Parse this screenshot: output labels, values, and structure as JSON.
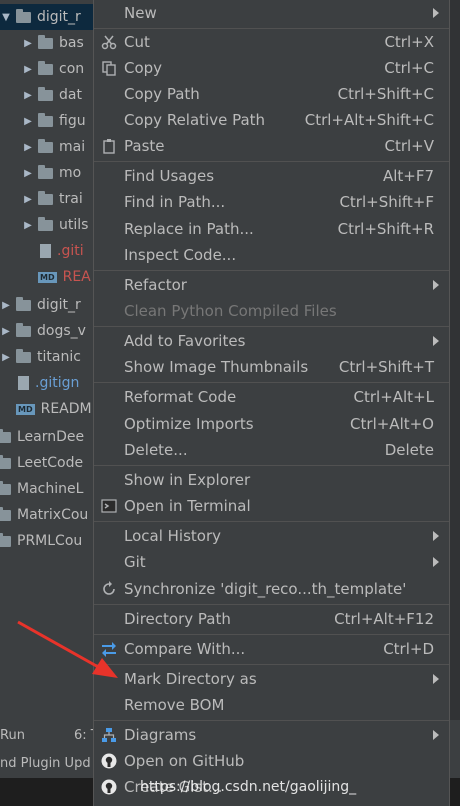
{
  "tree": {
    "items": [
      {
        "label": "digit_r",
        "arrow": "▼",
        "kind": "folder",
        "sel": true
      },
      {
        "label": "bas",
        "arrow": "▶",
        "kind": "folder"
      },
      {
        "label": "con",
        "arrow": "▶",
        "kind": "folder"
      },
      {
        "label": "dat",
        "arrow": "▶",
        "kind": "folder"
      },
      {
        "label": "figu",
        "arrow": "▶",
        "kind": "folder"
      },
      {
        "label": "mai",
        "arrow": "▶",
        "kind": "folder"
      },
      {
        "label": "mo",
        "arrow": "▶",
        "kind": "folder"
      },
      {
        "label": "trai",
        "arrow": "▶",
        "kind": "folder"
      },
      {
        "label": "utils",
        "arrow": "▶",
        "kind": "folder"
      },
      {
        "label": ".giti",
        "arrow": "",
        "kind": "file-red"
      },
      {
        "label": "REA",
        "arrow": "",
        "kind": "md-red"
      },
      {
        "label": "digit_r",
        "arrow": "▶",
        "kind": "folder"
      },
      {
        "label": "dogs_v",
        "arrow": "▶",
        "kind": "folder"
      },
      {
        "label": "titanic",
        "arrow": "▶",
        "kind": "folder"
      },
      {
        "label": ".gitign",
        "arrow": "",
        "kind": "file-blue"
      },
      {
        "label": "READM",
        "arrow": "",
        "kind": "md"
      },
      {
        "label": "LearnDee",
        "arrow": "",
        "kind": "folder"
      },
      {
        "label": "LeetCode",
        "arrow": "",
        "kind": "folder"
      },
      {
        "label": "MachineL",
        "arrow": "",
        "kind": "folder"
      },
      {
        "label": "MatrixCou",
        "arrow": "",
        "kind": "folder"
      },
      {
        "label": "PRMLCou",
        "arrow": "",
        "kind": "folder"
      }
    ]
  },
  "bottom": {
    "run": "Run",
    "tab6": "6: T",
    "plugin": "nd Plugin Upd"
  },
  "menu": {
    "items": [
      {
        "label": "New",
        "shortcut": "",
        "submenu": true
      },
      {
        "label": "Cut",
        "shortcut": "Ctrl+X",
        "icon": "scissors-icon"
      },
      {
        "label": "Copy",
        "shortcut": "Ctrl+C",
        "icon": "copy-icon"
      },
      {
        "label": "Copy Path",
        "shortcut": "Ctrl+Shift+C"
      },
      {
        "label": "Copy Relative Path",
        "shortcut": "Ctrl+Alt+Shift+C"
      },
      {
        "label": "Paste",
        "shortcut": "Ctrl+V",
        "icon": "paste-icon"
      },
      {
        "label": "Find Usages",
        "shortcut": "Alt+F7"
      },
      {
        "label": "Find in Path...",
        "shortcut": "Ctrl+Shift+F"
      },
      {
        "label": "Replace in Path...",
        "shortcut": "Ctrl+Shift+R"
      },
      {
        "label": "Inspect Code...",
        "shortcut": ""
      },
      {
        "label": "Refactor",
        "shortcut": "",
        "submenu": true
      },
      {
        "label": "Clean Python Compiled Files",
        "shortcut": "",
        "disabled": true
      },
      {
        "label": "Add to Favorites",
        "shortcut": "",
        "submenu": true
      },
      {
        "label": "Show Image Thumbnails",
        "shortcut": "Ctrl+Shift+T"
      },
      {
        "label": "Reformat Code",
        "shortcut": "Ctrl+Alt+L"
      },
      {
        "label": "Optimize Imports",
        "shortcut": "Ctrl+Alt+O"
      },
      {
        "label": "Delete...",
        "shortcut": "Delete"
      },
      {
        "label": "Show in Explorer",
        "shortcut": ""
      },
      {
        "label": "Open in Terminal",
        "shortcut": "",
        "icon": "terminal-icon"
      },
      {
        "label": "Local History",
        "shortcut": "",
        "submenu": true
      },
      {
        "label": "Git",
        "shortcut": "",
        "submenu": true
      },
      {
        "label": "Synchronize 'digit_reco...th_template'",
        "shortcut": "",
        "icon": "sync-icon"
      },
      {
        "label": "Directory Path",
        "shortcut": "Ctrl+Alt+F12"
      },
      {
        "label": "Compare With...",
        "shortcut": "Ctrl+D",
        "icon": "compare-icon"
      },
      {
        "label": "Mark Directory as",
        "shortcut": "",
        "submenu": true
      },
      {
        "label": "Remove BOM",
        "shortcut": ""
      },
      {
        "label": "Diagrams",
        "shortcut": "",
        "submenu": true,
        "icon": "diagram-icon"
      },
      {
        "label": "Open on GitHub",
        "shortcut": "",
        "icon": "github-icon"
      },
      {
        "label": "Create Gist...",
        "shortcut": "",
        "icon": "github-icon"
      }
    ]
  },
  "watermark": "https://blog.csdn.net/gaolijing_",
  "colors": {
    "accent_arrow": "#e8332a",
    "menu_bg": "#3c3f41",
    "tree_bg": "#3c3f41"
  }
}
